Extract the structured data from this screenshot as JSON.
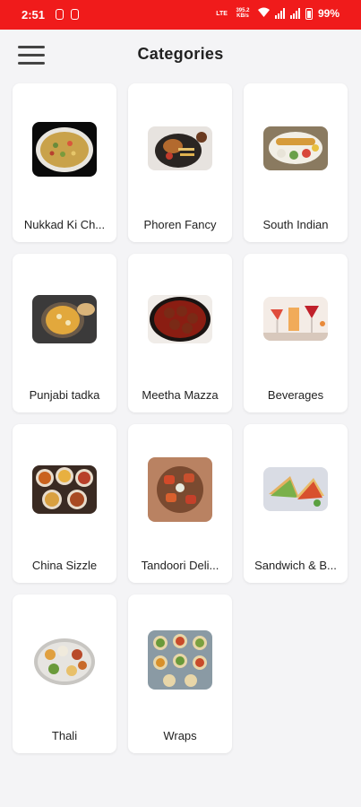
{
  "status_bar": {
    "time": "2:51",
    "network": "LTE",
    "speed": "395.2 KB/s",
    "battery": "99%"
  },
  "header": {
    "title": "Categories",
    "menu_icon": "hamburger-menu-icon"
  },
  "categories": [
    {
      "label": "Nukkad Ki Ch...",
      "image": "nukkad-food-image"
    },
    {
      "label": "Phoren Fancy",
      "image": "phoren-fancy-food-image"
    },
    {
      "label": "South Indian",
      "image": "south-indian-food-image"
    },
    {
      "label": "Punjabi tadka",
      "image": "punjabi-tadka-food-image"
    },
    {
      "label": "Meetha Mazza",
      "image": "meetha-mazza-food-image"
    },
    {
      "label": "Beverages",
      "image": "beverages-image"
    },
    {
      "label": "China Sizzle",
      "image": "china-sizzle-food-image"
    },
    {
      "label": "Tandoori Deli...",
      "image": "tandoori-food-image"
    },
    {
      "label": "Sandwich & B...",
      "image": "sandwich-food-image"
    },
    {
      "label": "Thali",
      "image": "thali-food-image"
    },
    {
      "label": "Wraps",
      "image": "wraps-food-image"
    }
  ],
  "colors": {
    "status_bar": "#f01b1b",
    "background": "#f4f4f6",
    "card": "#ffffff",
    "text": "#222222"
  }
}
